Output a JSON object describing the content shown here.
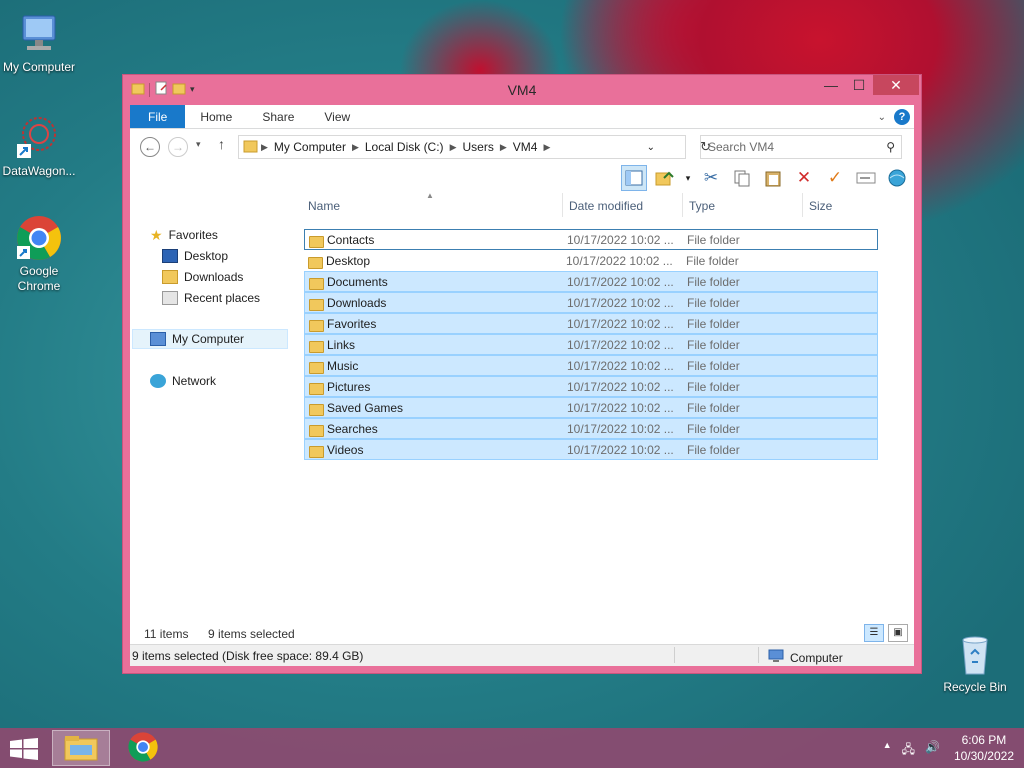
{
  "desktop": {
    "icons": [
      {
        "label": "My Computer"
      },
      {
        "label": "DataWagon..."
      },
      {
        "label": "Google Chrome"
      },
      {
        "label": "Recycle Bin"
      }
    ]
  },
  "window": {
    "title": "VM4",
    "caption": {
      "minimize": "—",
      "maximize": "☐",
      "close": "✕"
    },
    "ribbon_tabs": [
      "File",
      "Home",
      "Share",
      "View"
    ],
    "address": {
      "segments": [
        "My Computer",
        "Local Disk (C:)",
        "Users",
        "VM4"
      ]
    },
    "search": {
      "placeholder": "Search VM4"
    },
    "nav": {
      "favorites": "Favorites",
      "desktop": "Desktop",
      "downloads": "Downloads",
      "recent": "Recent places",
      "computer": "My Computer",
      "network": "Network"
    },
    "columns": [
      "Name",
      "Date modified",
      "Type",
      "Size"
    ],
    "files": [
      {
        "name": "Contacts",
        "date": "10/17/2022 10:02 ...",
        "type": "File folder"
      },
      {
        "name": "Desktop",
        "date": "10/17/2022 10:02 ...",
        "type": "File folder"
      },
      {
        "name": "Documents",
        "date": "10/17/2022 10:02 ...",
        "type": "File folder"
      },
      {
        "name": "Downloads",
        "date": "10/17/2022 10:02 ...",
        "type": "File folder"
      },
      {
        "name": "Favorites",
        "date": "10/17/2022 10:02 ...",
        "type": "File folder"
      },
      {
        "name": "Links",
        "date": "10/17/2022 10:02 ...",
        "type": "File folder"
      },
      {
        "name": "Music",
        "date": "10/17/2022 10:02 ...",
        "type": "File folder"
      },
      {
        "name": "Pictures",
        "date": "10/17/2022 10:02 ...",
        "type": "File folder"
      },
      {
        "name": "Saved Games",
        "date": "10/17/2022 10:02 ...",
        "type": "File folder"
      },
      {
        "name": "Searches",
        "date": "10/17/2022 10:02 ...",
        "type": "File folder"
      },
      {
        "name": "Videos",
        "date": "10/17/2022 10:02 ...",
        "type": "File folder"
      }
    ],
    "status": {
      "item_count": "11 items",
      "selected_count": "9 items selected",
      "bar_left": "9 items selected (Disk free space: 89.4 GB)",
      "bar_right": "Computer"
    }
  },
  "taskbar": {
    "time": "6:06 PM",
    "date": "10/30/2022"
  },
  "colors": {
    "window_frame": "#e9709a",
    "selection": "#cce8ff",
    "file_tab": "#1979ca"
  }
}
